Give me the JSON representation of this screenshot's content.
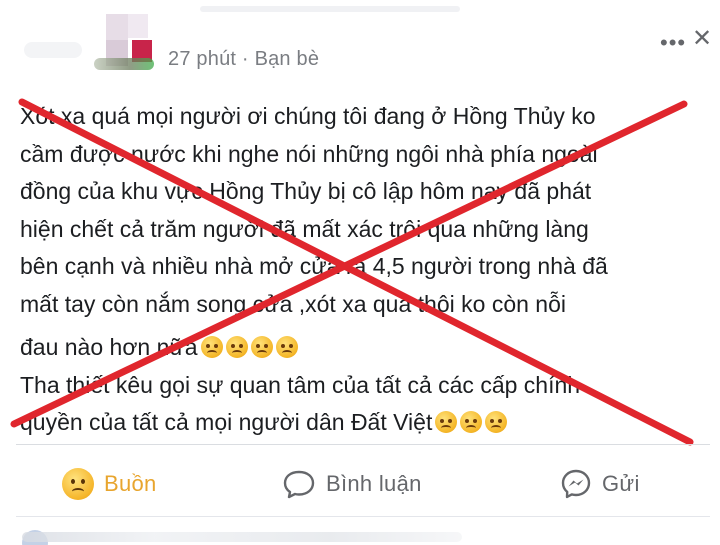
{
  "header": {
    "timestamp_prefix": "27",
    "timestamp_unit": "phút",
    "separator": "·",
    "audience": "Bạn bè"
  },
  "post": {
    "lines": [
      "Xót xa quá mọi người ơi chúng tôi đang ở Hồng Thủy ko",
      "cầm được nước khi nghe nói những ngôi nhà phía ngoài",
      "đồng của khu vực Hồng Thủy bị cô lập hôm nay đã phát",
      "hiện chết cả trăm người đã mất xác trôi qua những làng",
      "bên cạnh và nhiều nhà mở cửa ra 4,5 người trong nhà đã",
      "mất tay còn nắm song cửa ,xót xa quá thôi ko còn nỗi",
      "đau nào hơn nữa",
      "Tha thiết kêu gọi sự quan tâm của tất cả các cấp chính",
      "quyền của tất cả mọi người dân Đất Việt"
    ]
  },
  "overlay": {
    "x_color": "#e0262d"
  },
  "actions": {
    "reaction_label": "Buồn",
    "comment_label": "Bình luận",
    "send_label": "Gửi"
  },
  "colors": {
    "reaction_accent": "#e8a52e",
    "muted_text": "#65676b"
  }
}
